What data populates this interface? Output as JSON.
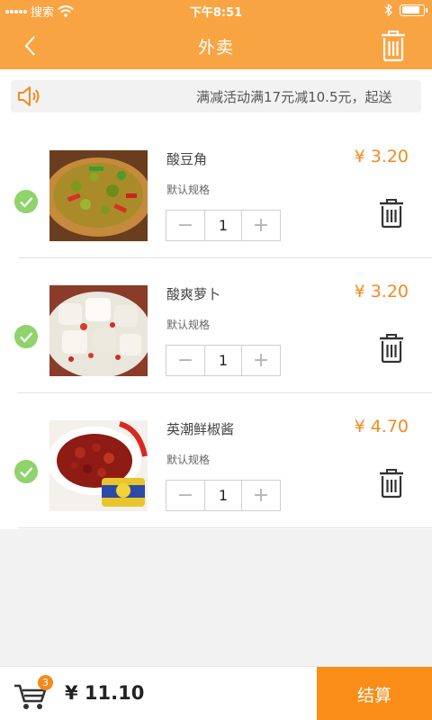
{
  "status_bar": {
    "carrier": "搜索",
    "time": "下午8:51"
  },
  "nav": {
    "title": "外卖"
  },
  "notice": {
    "text": "满减活动满17元减10.5元，起送"
  },
  "cart_items": [
    {
      "name": "酸豆角",
      "spec": "默认规格",
      "quantity": "1",
      "price": "¥ 3.20",
      "image": "pickled-beans"
    },
    {
      "name": "酸爽萝卜",
      "spec": "默认规格",
      "quantity": "1",
      "price": "¥ 3.20",
      "image": "pickled-radish"
    },
    {
      "name": "英潮鲜椒酱",
      "spec": "默认规格",
      "quantity": "1",
      "price": "¥ 4.70",
      "image": "chili-sauce"
    }
  ],
  "footer": {
    "cart_count": "3",
    "total": "¥ 11.10",
    "checkout_label": "结算"
  },
  "colors": {
    "accent": "#f9a443",
    "price": "#f48a1d",
    "check": "#8fd36c",
    "checkout": "#f98d17"
  },
  "icons": {
    "back": "chevron-left-icon",
    "trash": "trash-icon",
    "speaker": "speaker-icon",
    "check": "check-icon",
    "cart": "cart-icon",
    "minus": "minus-icon",
    "plus": "plus-icon"
  }
}
